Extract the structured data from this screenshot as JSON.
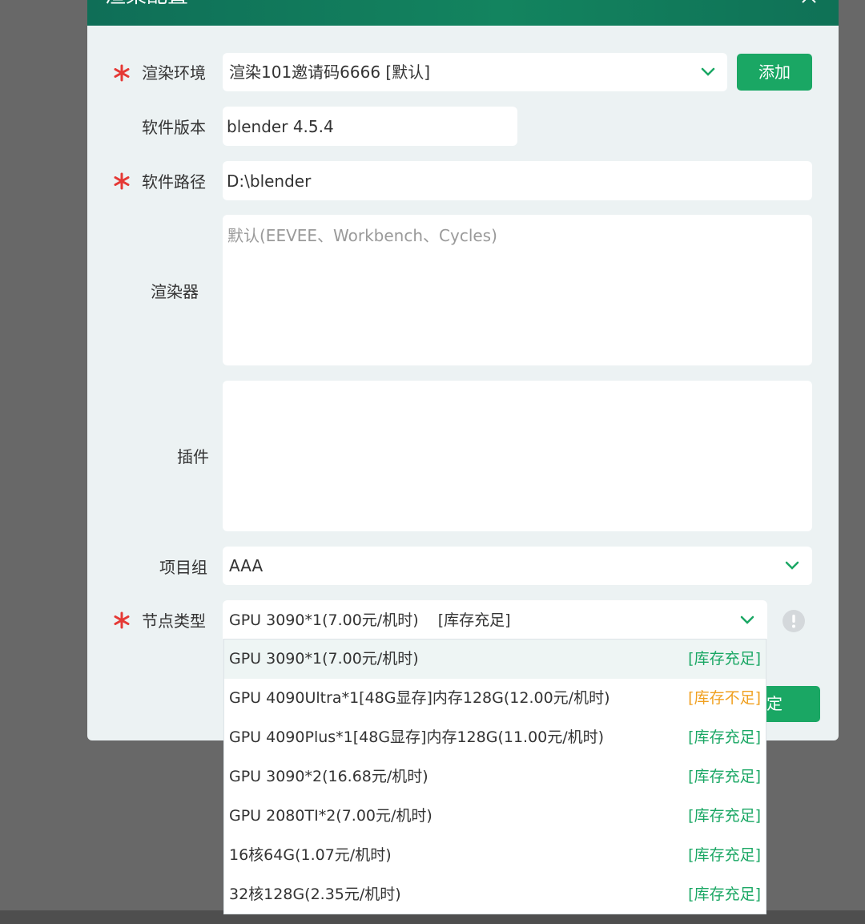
{
  "dialog": {
    "title": "渲染配置"
  },
  "form": {
    "render_env": {
      "label": "渲染环境",
      "value": "渲染101邀请码6666 [默认]",
      "add_label": "添加"
    },
    "software_version": {
      "label": "软件版本",
      "value": "blender 4.5.4"
    },
    "software_path": {
      "label": "软件路径",
      "value": "D:\\blender"
    },
    "renderer": {
      "label": "渲染器",
      "placeholder": "默认(EEVEE、Workbench、Cycles)"
    },
    "plugins": {
      "label": "插件",
      "value": ""
    },
    "project_group": {
      "label": "项目组",
      "value": "AAA"
    },
    "node_type": {
      "label": "节点类型",
      "value": "GPU 3090*1(7.00元/机时)    [库存充足]"
    }
  },
  "confirm_label_partial": "定",
  "node_options": [
    {
      "label": "GPU 3090*1(7.00元/机时)",
      "stock": "[库存充足]",
      "stock_color": "#1aa764"
    },
    {
      "label": "GPU 4090Ultra*1[48G显存]内存128G(12.00元/机时)",
      "stock": "[库存不足]",
      "stock_color": "#f0a020"
    },
    {
      "label": "GPU 4090Plus*1[48G显存]内存128G(11.00元/机时)",
      "stock": "[库存充足]",
      "stock_color": "#1aa764"
    },
    {
      "label": "GPU 3090*2(16.68元/机时)",
      "stock": "[库存充足]",
      "stock_color": "#1aa764"
    },
    {
      "label": "GPU 2080TI*2(7.00元/机时)",
      "stock": "[库存充足]",
      "stock_color": "#1aa764"
    },
    {
      "label": "16核64G(1.07元/机时)",
      "stock": "[库存充足]",
      "stock_color": "#1aa764"
    },
    {
      "label": "32核128G(2.35元/机时)",
      "stock": "[库存充足]",
      "stock_color": "#1aa764"
    }
  ],
  "colors": {
    "accent": "#1aa764",
    "header": "#13845f",
    "required": "#e53935"
  },
  "icons": {
    "required": "asterisk-icon",
    "dropdown": "chevron-down-icon",
    "more": "ellipsis-icon",
    "info": "info-icon",
    "close": "close-icon"
  }
}
